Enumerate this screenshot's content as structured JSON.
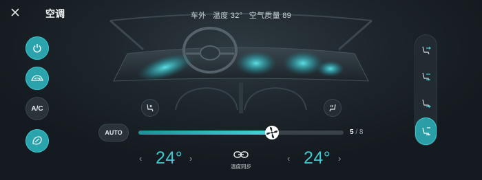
{
  "header": {
    "title": "空调",
    "outside_label": "车外",
    "temperature_text": "温度 32°",
    "air_quality_text": "空气质量 89"
  },
  "left_controls": [
    {
      "name": "power-button",
      "icon": "power-icon",
      "active": true
    },
    {
      "name": "recirculation-button",
      "icon": "car-recirculation-icon",
      "active": true
    },
    {
      "name": "ac-button",
      "label": "A/C",
      "active": false
    },
    {
      "name": "climate-mode-button",
      "icon": "air-purify-icon",
      "active": true
    }
  ],
  "seat_heat": {
    "left_icon": "seat-heat-icon",
    "right_icon": "seat-heat-icon"
  },
  "airflow_modes": [
    {
      "name": "airflow-face",
      "icon": "seat-airflow-face-icon",
      "selected": false
    },
    {
      "name": "airflow-face-feet",
      "icon": "seat-airflow-face-feet-icon",
      "selected": false
    },
    {
      "name": "airflow-feet",
      "icon": "seat-airflow-feet-icon",
      "selected": false
    },
    {
      "name": "airflow-feet-windshield",
      "icon": "seat-airflow-feet-defrost-icon",
      "selected": true
    }
  ],
  "fan": {
    "auto_label": "AUTO",
    "level": 5,
    "max": 8,
    "level_text": "5",
    "max_text": "/ 8",
    "fill_fraction": 0.65
  },
  "temperature": {
    "driver": "24°",
    "passenger": "24°",
    "left_arrow": "‹",
    "right_arrow": "›",
    "sync_label": "温度同步"
  },
  "colors": {
    "accent": "#3fc9cf",
    "active_button": "#2aa3ac",
    "background": "#161d22"
  }
}
